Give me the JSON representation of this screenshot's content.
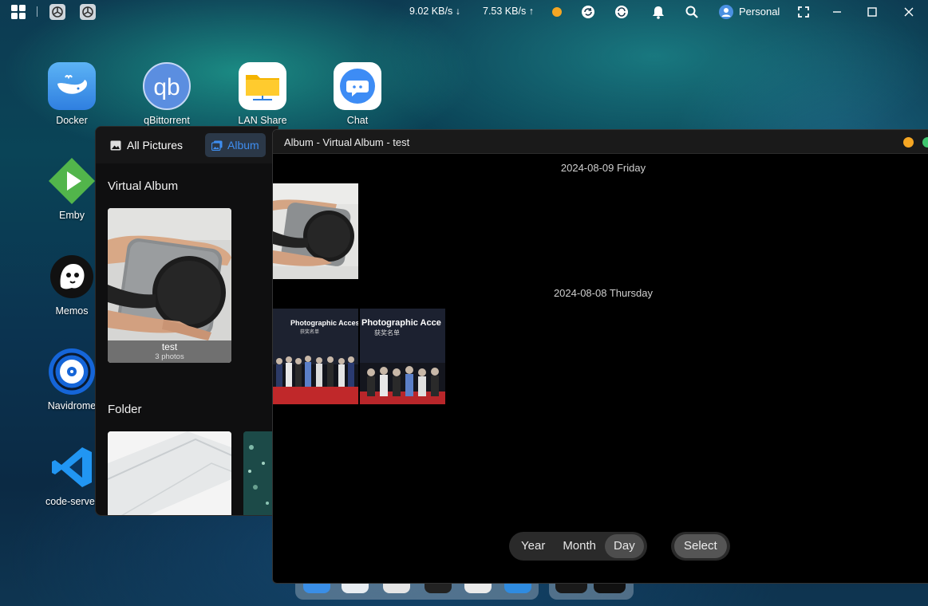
{
  "topbar": {
    "download_speed": "9.02 KB/s",
    "upload_speed": "7.53 KB/s",
    "download_arrow": "↓",
    "upload_arrow": "↑",
    "user_name": "Personal",
    "status_dot_color": "#f5a623"
  },
  "desktop": {
    "icons": [
      {
        "label": "Docker"
      },
      {
        "label": "qBittorrent"
      },
      {
        "label": "LAN Share"
      },
      {
        "label": "Chat"
      },
      {
        "label": "Emby"
      },
      {
        "label": "Memos"
      },
      {
        "label": "Navidrome"
      },
      {
        "label": "code-server"
      }
    ]
  },
  "photos_panel": {
    "nav": {
      "all_pictures": "All Pictures",
      "album": "Album"
    },
    "virtual_album_title": "Virtual Album",
    "album": {
      "name": "test",
      "count": "3 photos"
    },
    "folder_title": "Folder"
  },
  "album_window": {
    "title": "Album - Virtual Album - test",
    "groups": [
      {
        "date": "2024-08-09 Friday"
      },
      {
        "date": "2024-08-08 Thursday"
      }
    ],
    "photo_text": {
      "banner": "Photographic Accessories",
      "banner2": "Photographic Acce",
      "subtitle": "获奖名单"
    },
    "view_modes": {
      "year": "Year",
      "month": "Month",
      "day": "Day",
      "active": "Day"
    },
    "select_label": "Select"
  },
  "colors": {
    "accent": "#3f8ef0",
    "close_dot": "#f5a623",
    "max_dot": "#3ec46d"
  }
}
